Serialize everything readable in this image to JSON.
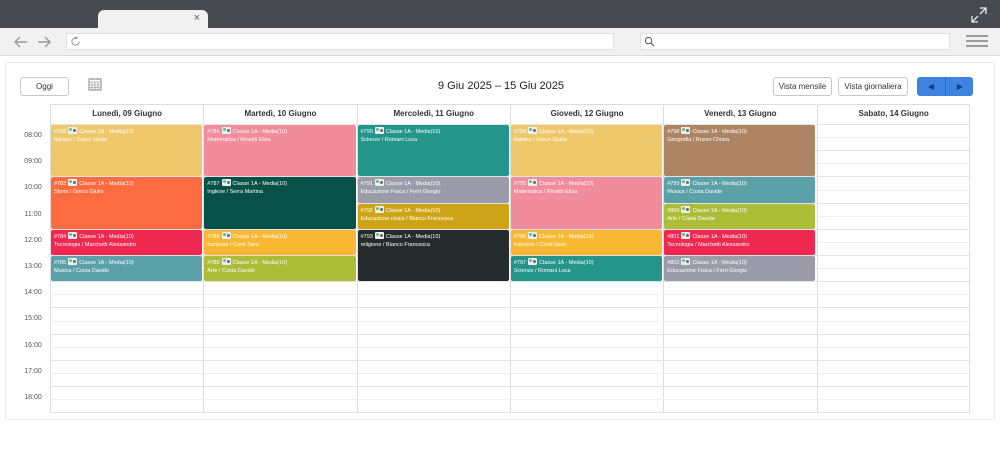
{
  "toolbar": {
    "back_icon": "arrow-left-icon",
    "forward_icon": "arrow-right-icon",
    "reload_icon": "reload-icon",
    "search_icon": "search-icon",
    "menu_icon": "hamburger-menu-icon"
  },
  "tab": {
    "close": "×"
  },
  "calendar": {
    "today_label": "Oggi",
    "range_title": "9 Giu 2025 – 15 Giu 2025",
    "month_view_label": "Vista mensile",
    "day_view_label": "Vista giornaliera",
    "prev_label": "◀",
    "next_label": "▶",
    "days": [
      "Lunedì, 09 Giugno",
      "Martedì, 10 Giugno",
      "Mercoledì, 11 Giugno",
      "Giovedì, 12 Giugno",
      "Venerdì, 13 Giugno",
      "Sabato, 14 Giugno"
    ],
    "hours": [
      "08:00",
      "09:00",
      "10:00",
      "11:00",
      "12:00",
      "13:00",
      "14:00",
      "15:00",
      "16:00",
      "17:00",
      "18:00"
    ],
    "events": [
      {
        "day": 0,
        "start": 8,
        "end": 10,
        "id": "#782",
        "cls": "Classe 1A - Media(10)",
        "subject": "Italiano / Greco Giulio",
        "color": "#f0c86c"
      },
      {
        "day": 0,
        "start": 10,
        "end": 12,
        "id": "#783",
        "cls": "Classe 1A - Media(10)",
        "subject": "Storia / Greco Giulio",
        "color": "#fd6b40"
      },
      {
        "day": 0,
        "start": 12,
        "end": 13,
        "id": "#784",
        "cls": "Classe 1A - Media(10)",
        "subject": "Tecnologia / Marchetti Alessandro",
        "color": "#ee2851"
      },
      {
        "day": 0,
        "start": 13,
        "end": 14,
        "id": "#785",
        "cls": "Classe 1A - Media(10)",
        "subject": "Musica / Costa Davide",
        "color": "#5ca0aa"
      },
      {
        "day": 1,
        "start": 8,
        "end": 10,
        "id": "#786",
        "cls": "Classe 1A - Media(10)",
        "subject": "Matematica / Rinaldi Elisa",
        "color": "#f08c9c"
      },
      {
        "day": 1,
        "start": 10,
        "end": 12,
        "id": "#787",
        "cls": "Classe 1A - Media(10)",
        "subject": "Inglese / Serra Martina",
        "color": "#075149"
      },
      {
        "day": 1,
        "start": 12,
        "end": 13,
        "id": "#788",
        "cls": "Classe 1A - Media(10)",
        "subject": "francese / Conti Sara",
        "color": "#f8b833"
      },
      {
        "day": 1,
        "start": 13,
        "end": 14,
        "id": "#789",
        "cls": "Classe 1A - Media(10)",
        "subject": "Arte / Costa Davide",
        "color": "#acbd38"
      },
      {
        "day": 2,
        "start": 8,
        "end": 10,
        "id": "#790",
        "cls": "Classe 1A - Media(10)",
        "subject": "Scienze / Romani Luca",
        "color": "#24958a"
      },
      {
        "day": 2,
        "start": 10,
        "end": 11,
        "id": "#791",
        "cls": "Classe 1A - Media(10)",
        "subject": "Educazione Fisica / Ferri Giorgio",
        "color": "#9c9ba9"
      },
      {
        "day": 2,
        "start": 11,
        "end": 12,
        "id": "#792",
        "cls": "Classe 1A - Media(10)",
        "subject": "Educazione civica / Bianco Francesca",
        "color": "#cda418"
      },
      {
        "day": 2,
        "start": 12,
        "end": 14,
        "id": "#793",
        "cls": "Classe 1A - Media(10)",
        "subject": "religione / Bianco Francesca",
        "color": "#252a2d"
      },
      {
        "day": 3,
        "start": 8,
        "end": 10,
        "id": "#794",
        "cls": "Classe 1A - Media(10)",
        "subject": "Italiano / Greco Giulio",
        "color": "#f0c86c"
      },
      {
        "day": 3,
        "start": 10,
        "end": 12,
        "id": "#795",
        "cls": "Classe 1A - Media(10)",
        "subject": "Matematica / Rinaldi Elisa",
        "color": "#f08c9c"
      },
      {
        "day": 3,
        "start": 12,
        "end": 13,
        "id": "#796",
        "cls": "Classe 1A - Media(10)",
        "subject": "francese / Conti Sara",
        "color": "#f8b833"
      },
      {
        "day": 3,
        "start": 13,
        "end": 14,
        "id": "#797",
        "cls": "Classe 1A - Media(10)",
        "subject": "Scienze / Romani Luca",
        "color": "#24958a"
      },
      {
        "day": 4,
        "start": 8,
        "end": 10,
        "id": "#798",
        "cls": "Classe 1A - Media(10)",
        "subject": "Geografia / Russo Chiara",
        "color": "#ad8564"
      },
      {
        "day": 4,
        "start": 10,
        "end": 11,
        "id": "#799",
        "cls": "Classe 1A - Media(10)",
        "subject": "Musica / Costa Davide",
        "color": "#5ca0aa"
      },
      {
        "day": 4,
        "start": 11,
        "end": 12,
        "id": "#800",
        "cls": "Classe 1A - Media(10)",
        "subject": "Arte / Costa Davide",
        "color": "#acbd38"
      },
      {
        "day": 4,
        "start": 12,
        "end": 13,
        "id": "#801",
        "cls": "Classe 1A - Media(10)",
        "subject": "Tecnologia / Marchetti Alessandro",
        "color": "#ee2851"
      },
      {
        "day": 4,
        "start": 13,
        "end": 14,
        "id": "#802",
        "cls": "Classe 1A - Media(10)",
        "subject": "Educazione Fisica / Ferri Giorgio",
        "color": "#9c9ba9"
      }
    ]
  }
}
